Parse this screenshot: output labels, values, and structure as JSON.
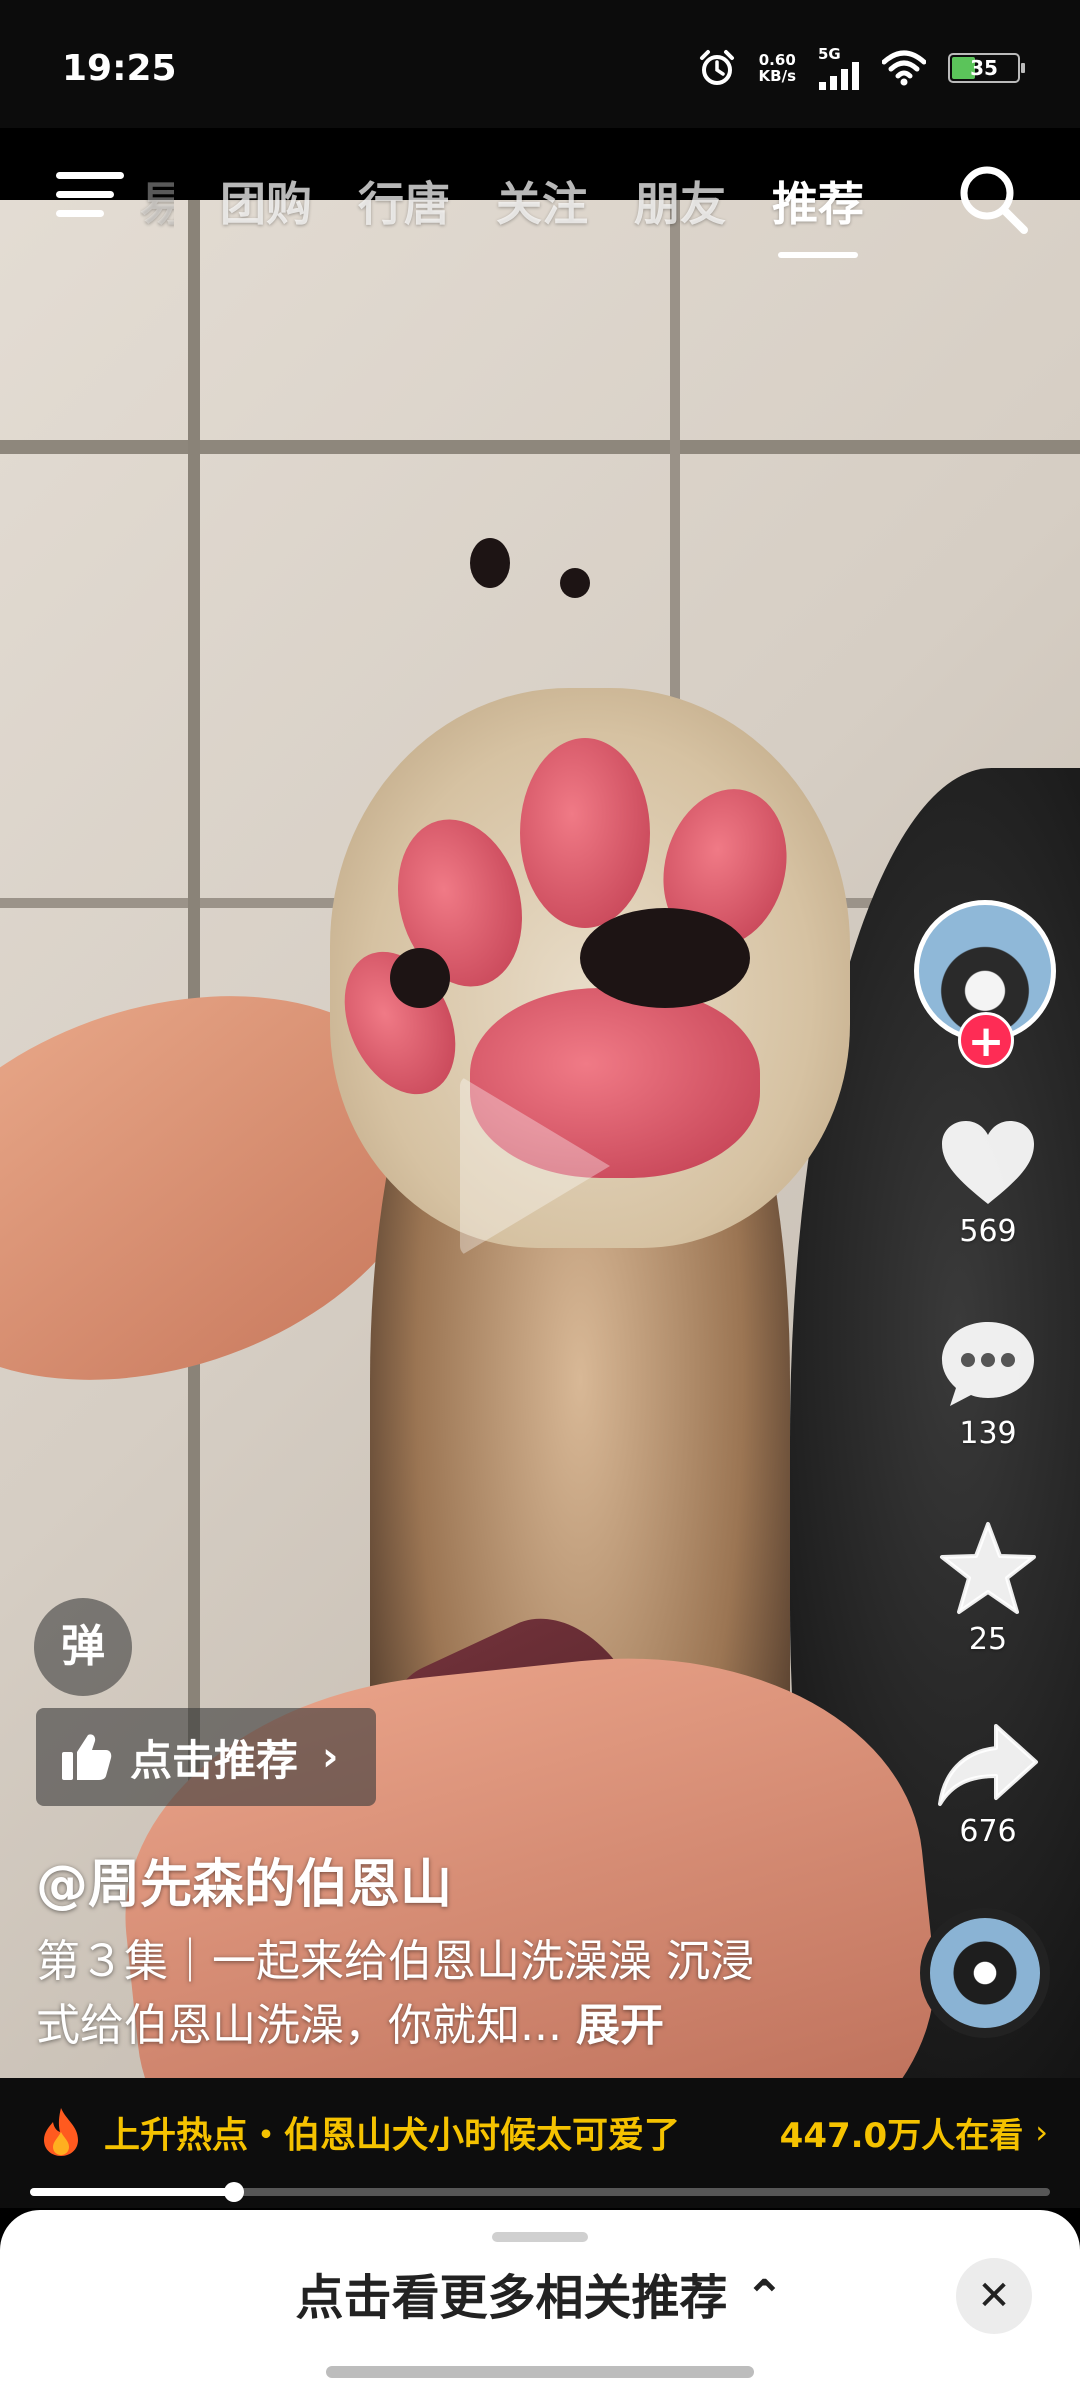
{
  "status_bar": {
    "time": "19:25",
    "net_speed_value": "0.60",
    "net_speed_unit": "KB/s",
    "network": "5G",
    "battery": "35",
    "icons": [
      "alarm-icon",
      "signal-icon",
      "wifi-icon",
      "battery-icon"
    ]
  },
  "top_nav": {
    "tabs": [
      {
        "label": "团购",
        "active": false
      },
      {
        "label": "行唐",
        "active": false
      },
      {
        "label": "关注",
        "active": false
      },
      {
        "label": "朋友",
        "active": false
      },
      {
        "label": "推荐",
        "active": true
      }
    ],
    "cut_tab": "易"
  },
  "actions": {
    "follow_symbol": "+",
    "likes": "569",
    "comments": "139",
    "favorites": "25",
    "shares": "676"
  },
  "overlay": {
    "danmu_label": "弹",
    "recommend_label": "点击推荐",
    "recommend_chevron": "›"
  },
  "caption": {
    "author": "@周先森的伯恩山",
    "description": "第３集｜一起来给伯恩山洗澡澡 沉浸式给伯恩山洗澡，你就知...",
    "expand_label": "展开"
  },
  "hot_topic": {
    "text": "上升热点・伯恩山犬小时候太可爱了",
    "viewers": "447.0万人在看",
    "chevron": "›"
  },
  "playback": {
    "progress": 0.2
  },
  "bottom_sheet": {
    "title": "点击看更多相关推荐 ⌃",
    "close_symbol": "✕"
  },
  "colors": {
    "accent_red": "#fe2c55",
    "hot_yellow": "#f5c200"
  }
}
